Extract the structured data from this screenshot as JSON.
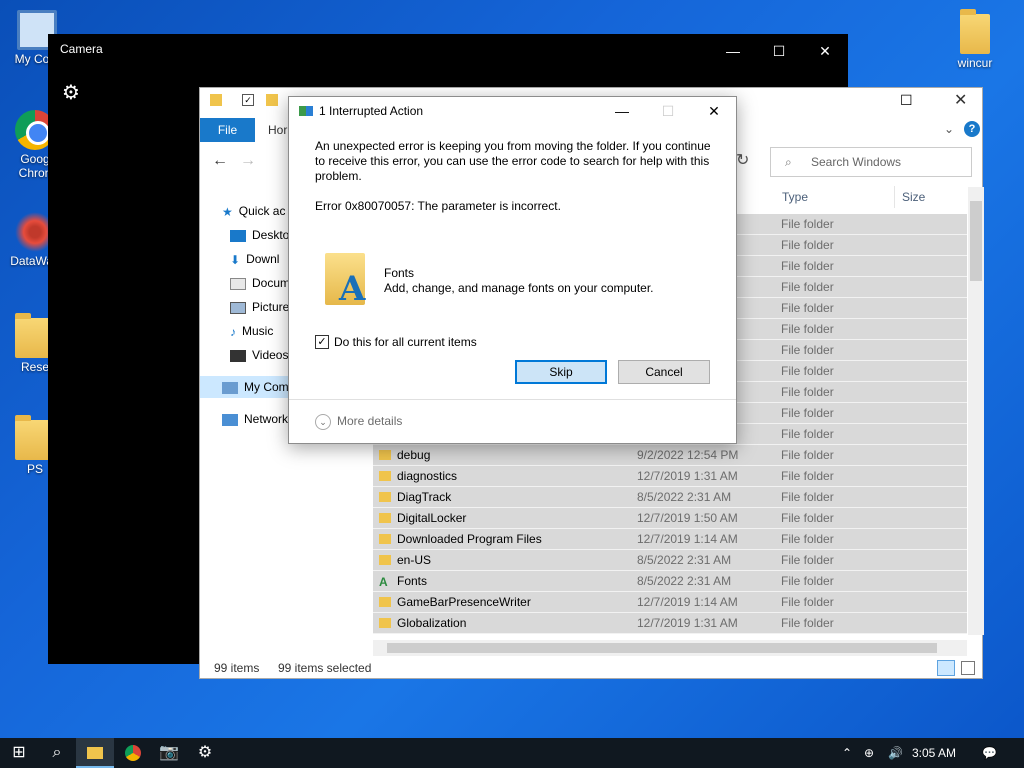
{
  "desktop": {
    "icons": [
      {
        "label": "My Com",
        "icon": "computer-icon"
      },
      {
        "label": "Goog\nChron",
        "icon": "chrome-icon"
      },
      {
        "label": "DataWag",
        "icon": "datawagon-icon"
      },
      {
        "label": "Rese",
        "icon": "folder-icon"
      },
      {
        "label": "PS",
        "icon": "folder-icon"
      },
      {
        "label": "wincur",
        "icon": "folder-icon"
      }
    ]
  },
  "camera": {
    "title": "Camera",
    "minimize": "—",
    "maximize": "☐",
    "close": "✕",
    "settings_icon": "gear-icon"
  },
  "explorer": {
    "ribbon": {
      "file_tab": "File",
      "home_tab": "Hor"
    },
    "search_placeholder": "Search Windows",
    "nav": [
      {
        "label": "Quick ac",
        "icon": "star-icon"
      },
      {
        "label": "Deskto",
        "icon": "desktop-icon"
      },
      {
        "label": "Downl",
        "icon": "download-icon"
      },
      {
        "label": "Docum",
        "icon": "document-icon"
      },
      {
        "label": "Picture",
        "icon": "picture-icon"
      },
      {
        "label": "Music",
        "icon": "music-icon"
      },
      {
        "label": "Videos",
        "icon": "video-icon"
      },
      {
        "label": "My Com",
        "icon": "computer-icon"
      },
      {
        "label": "Network",
        "icon": "network-icon"
      }
    ],
    "columns": {
      "type": "Type",
      "size": "Size"
    },
    "rows": [
      {
        "name": "",
        "date": "",
        "type": "File folder"
      },
      {
        "name": "",
        "date": "",
        "type": "File folder"
      },
      {
        "name": "",
        "date": "",
        "type": "File folder"
      },
      {
        "name": "",
        "date": "",
        "type": "File folder"
      },
      {
        "name": "",
        "date": "",
        "type": "File folder"
      },
      {
        "name": "",
        "date": "",
        "type": "File folder"
      },
      {
        "name": "",
        "date": "",
        "type": "File folder"
      },
      {
        "name": "",
        "date": "",
        "type": "File folder"
      },
      {
        "name": "",
        "date": "",
        "type": "File folder"
      },
      {
        "name": "",
        "date": "",
        "type": "File folder"
      },
      {
        "name": "",
        "date": "",
        "type": "File folder"
      },
      {
        "name": "debug",
        "date": "9/2/2022 12:54 PM",
        "type": "File folder"
      },
      {
        "name": "diagnostics",
        "date": "12/7/2019 1:31 AM",
        "type": "File folder"
      },
      {
        "name": "DiagTrack",
        "date": "8/5/2022 2:31 AM",
        "type": "File folder"
      },
      {
        "name": "DigitalLocker",
        "date": "12/7/2019 1:50 AM",
        "type": "File folder"
      },
      {
        "name": "Downloaded Program Files",
        "date": "12/7/2019 1:14 AM",
        "type": "File folder"
      },
      {
        "name": "en-US",
        "date": "8/5/2022 2:31 AM",
        "type": "File folder"
      },
      {
        "name": "Fonts",
        "date": "8/5/2022 2:31 AM",
        "type": "File folder"
      },
      {
        "name": "GameBarPresenceWriter",
        "date": "12/7/2019 1:14 AM",
        "type": "File folder"
      },
      {
        "name": "Globalization",
        "date": "12/7/2019 1:31 AM",
        "type": "File folder"
      }
    ],
    "status": {
      "items": "99 items",
      "selected": "99 items selected"
    }
  },
  "dialog": {
    "title": "1 Interrupted Action",
    "message": "An unexpected error is keeping you from moving the folder. If you continue to receive this error, you can use the error code to search for help with this problem.",
    "error": "Error 0x80070057: The parameter is incorrect.",
    "item_name": "Fonts",
    "item_desc": "Add, change, and manage fonts on your computer.",
    "checkbox_label": "Do this for all current items",
    "checkbox_checked": true,
    "skip": "Skip",
    "cancel": "Cancel",
    "more_details": "More details"
  },
  "taskbar": {
    "time": "3:05 AM",
    "items": [
      "start-icon",
      "search-icon",
      "file-explorer-icon",
      "chrome-icon",
      "camera-icon",
      "settings-icon"
    ]
  }
}
